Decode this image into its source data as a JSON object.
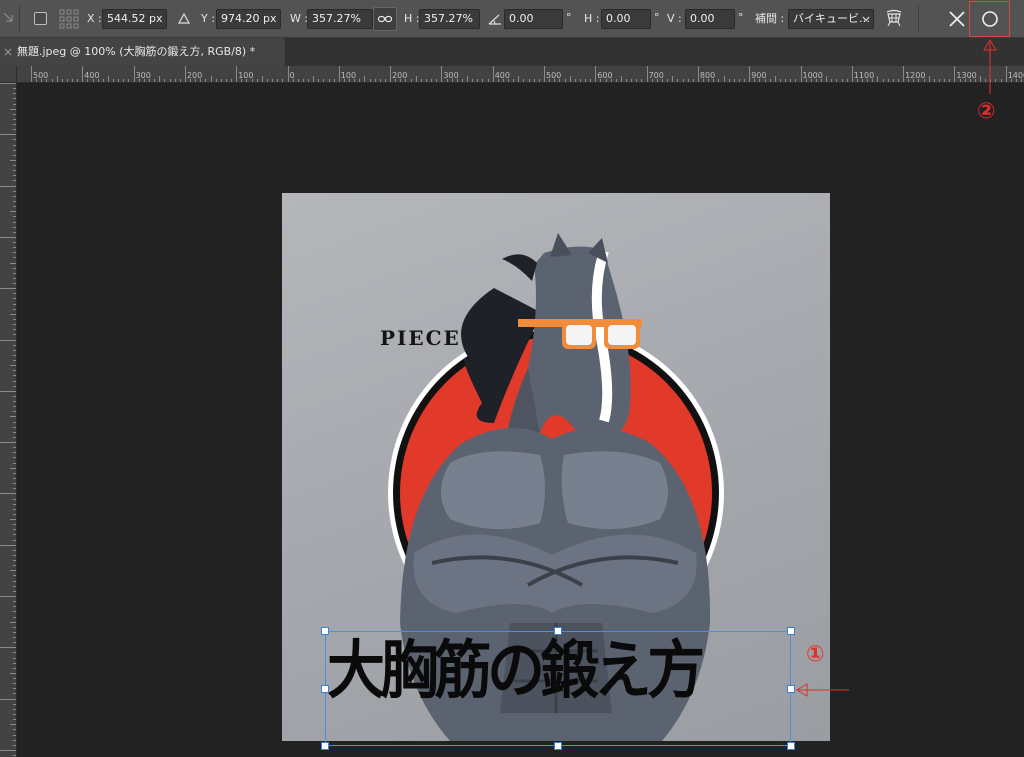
{
  "options_bar": {
    "x_label": "X :",
    "x_value": "544.52 px",
    "y_label": "Y :",
    "y_value": "974.20 px",
    "w_label": "W :",
    "w_value": "357.27%",
    "h_label": "H :",
    "h_value": "357.27%",
    "angle_value": "0.00",
    "degree_symbol": "°",
    "skew_h_label": "H :",
    "skew_h_value": "0.00",
    "skew_h_unit": "°",
    "skew_v_label": "V :",
    "skew_v_value": "0.00",
    "skew_v_unit": "°",
    "interp_label": "補間 :",
    "interp_value": "バイキュービ…",
    "icons": [
      "move-tool-icon",
      "reference-point-checkbox-icon",
      "reference-grid-icon",
      "delta-icon",
      "link-icon",
      "angle-icon",
      "chevron-down-icon",
      "warp-icon",
      "cancel-icon",
      "commit-icon"
    ]
  },
  "tab": {
    "close": "×",
    "title": "無題.jpeg @ 100% (大胸筋の鍛え方, RGB/8) *"
  },
  "ruler": {
    "horizontal_ticks": [
      "500",
      "400",
      "300",
      "200",
      "100",
      "0",
      "100",
      "200",
      "300",
      "400",
      "500",
      "600",
      "700",
      "800",
      "900",
      "1000",
      "1100",
      "1200",
      "1300",
      "1400"
    ]
  },
  "artwork": {
    "piece_text": "PIECE",
    "heading": "大胸筋の鍛え方",
    "colors": {
      "red": "#e23a2a",
      "body": "#5c6370",
      "background": "#a5a8ad"
    }
  },
  "annotations": {
    "one": "①",
    "two": "②",
    "color": "#e52d2d"
  }
}
